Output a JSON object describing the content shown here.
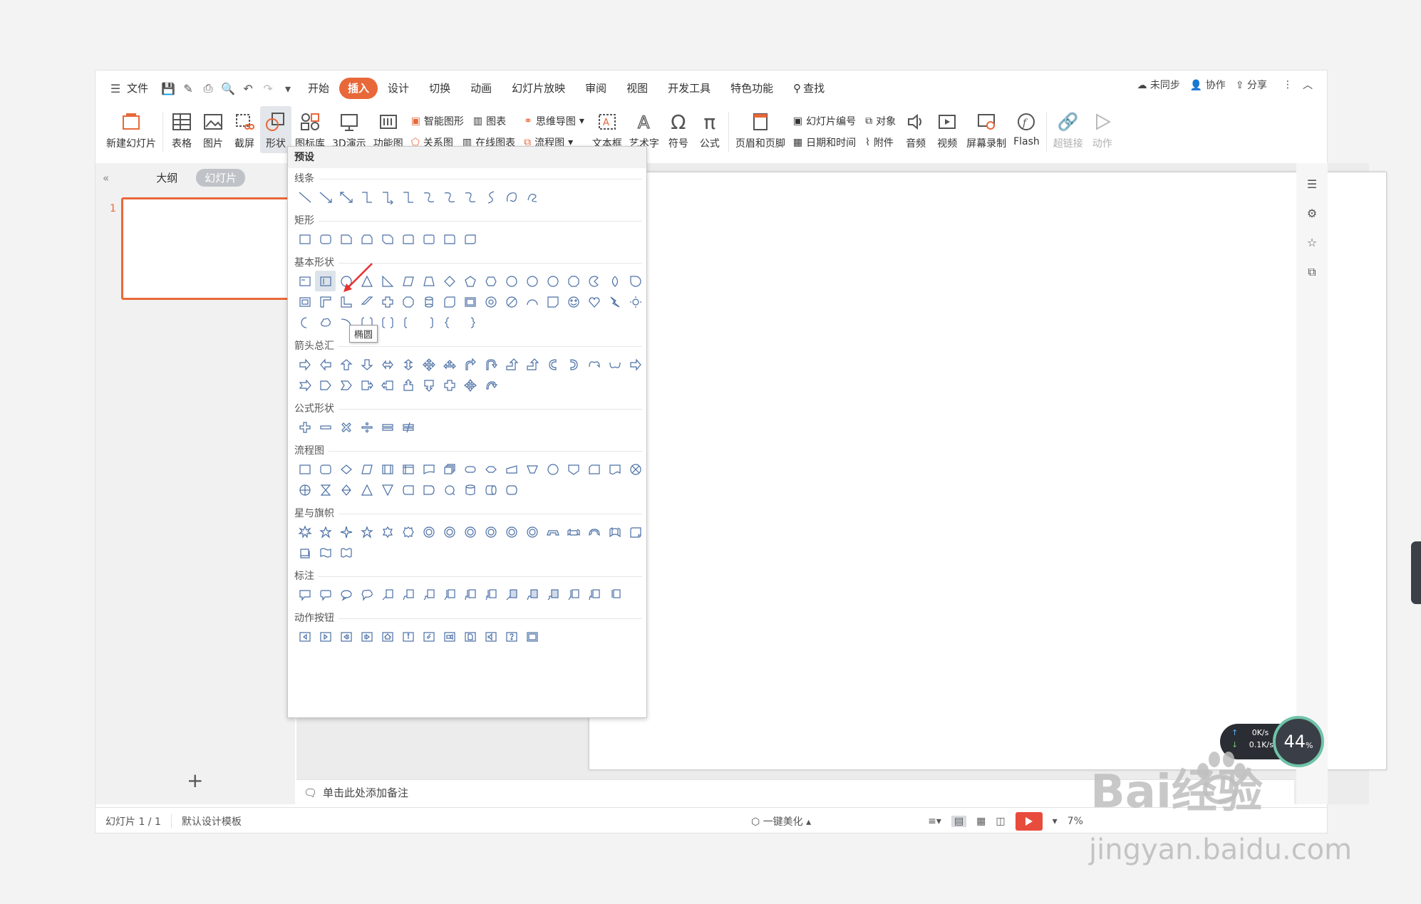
{
  "menubar": {
    "file": "文件",
    "tabs": [
      "开始",
      "插入",
      "设计",
      "切换",
      "动画",
      "幻灯片放映",
      "审阅",
      "视图",
      "开发工具",
      "特色功能"
    ],
    "active_tab": "插入",
    "search": "查找",
    "right": [
      "未同步",
      "协作",
      "分享"
    ]
  },
  "ribbon": {
    "new_slide": "新建幻灯片",
    "table": "表格",
    "picture": "图片",
    "screenshot": "截屏",
    "shape": "形状",
    "icon_lib": "图标库",
    "demo3d": "3D演示",
    "func_chart": "功能图",
    "smart_art": "智能图形",
    "chart": "图表",
    "mind_map": "思维导图",
    "relation": "关系图",
    "online_chart": "在线图表",
    "flowchart": "流程图",
    "textbox": "文本框",
    "wordart": "艺术字",
    "symbol": "符号",
    "formula": "公式",
    "header_footer": "页眉和页脚",
    "slide_num": "幻灯片编号",
    "object": "对象",
    "datetime": "日期和时间",
    "attachment": "附件",
    "audio": "音频",
    "video": "视频",
    "screen_rec": "屏幕录制",
    "flash": "Flash",
    "hyperlink": "超链接",
    "action": "动作"
  },
  "leftpanel": {
    "tab_outline": "大纲",
    "tab_slides": "幻灯片",
    "slide_number": "1",
    "add": "+"
  },
  "dropdown": {
    "header": "预设",
    "sections": [
      "线条",
      "矩形",
      "基本形状",
      "箭头总汇",
      "公式形状",
      "流程图",
      "星与旗帜",
      "标注",
      "动作按钮"
    ],
    "tooltip": "椭圆"
  },
  "notes": {
    "placeholder": "单击此处添加备注"
  },
  "status": {
    "slide_info": "幻灯片 1 / 1",
    "template": "默认设计模板",
    "beautify": "一键美化",
    "zoom": "7%"
  },
  "widgets": {
    "upload": "0K/s",
    "download": "0.1K/s",
    "percent": "44",
    "percent_unit": "%"
  },
  "watermark": {
    "brand": "Bai经验",
    "url": "jingyan.baidu.com"
  },
  "colors": {
    "accent": "#e8683a",
    "shape_stroke": "#4a6fa5",
    "play": "#e84c3d"
  }
}
